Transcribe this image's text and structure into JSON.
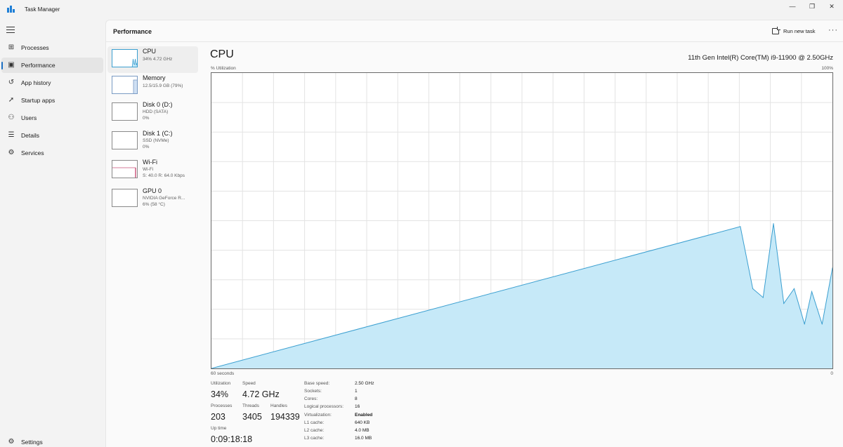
{
  "window": {
    "title": "Task Manager",
    "minimize": "—",
    "maximize": "❐",
    "close": "✕"
  },
  "nav": {
    "items": [
      {
        "label": "Processes",
        "icon": "processes-icon"
      },
      {
        "label": "Performance",
        "icon": "performance-icon",
        "selected": true
      },
      {
        "label": "App history",
        "icon": "app-history-icon"
      },
      {
        "label": "Startup apps",
        "icon": "startup-apps-icon"
      },
      {
        "label": "Users",
        "icon": "users-icon"
      },
      {
        "label": "Details",
        "icon": "details-icon"
      },
      {
        "label": "Services",
        "icon": "services-icon"
      }
    ],
    "settings": "Settings"
  },
  "header": {
    "title": "Performance",
    "run_new_task": "Run new task",
    "more": "···"
  },
  "resources": [
    {
      "name": "CPU",
      "line1": "34% 4.72 GHz",
      "line2": ""
    },
    {
      "name": "Memory",
      "line1": "12.5/15.9 GB (79%)",
      "line2": ""
    },
    {
      "name": "Disk 0 (D:)",
      "line1": "HDD (SATA)",
      "line2": "0%"
    },
    {
      "name": "Disk 1 (C:)",
      "line1": "SSD (NVMe)",
      "line2": "0%"
    },
    {
      "name": "Wi-Fi",
      "line1": "Wi-Fi",
      "line2": "S: 40.0 R: 64.0 Kbps"
    },
    {
      "name": "GPU 0",
      "line1": "NVIDIA GeForce R...",
      "line2": "6% (58 °C)"
    }
  ],
  "cpu": {
    "title": "CPU",
    "model": "11th Gen Intel(R) Core(TM) i9-11900 @ 2.50GHz",
    "util_label": "% Utilization",
    "util_max": "100%",
    "time_label": "60 seconds",
    "zero_label": "0",
    "colors": {
      "fill": "#c6e9f8",
      "line": "#3b9fd0",
      "grid": "#e3e3e3"
    }
  },
  "stats": {
    "utilization_label": "Utilization",
    "utilization": "34%",
    "speed_label": "Speed",
    "speed": "4.72 GHz",
    "processes_label": "Processes",
    "processes": "203",
    "threads_label": "Threads",
    "threads": "3405",
    "handles_label": "Handles",
    "handles": "194339",
    "uptime_label": "Up time",
    "uptime": "0:09:18:18"
  },
  "specs": [
    {
      "label": "Base speed:",
      "value": "2.50 GHz"
    },
    {
      "label": "Sockets:",
      "value": "1"
    },
    {
      "label": "Cores:",
      "value": "8"
    },
    {
      "label": "Logical processors:",
      "value": "16"
    },
    {
      "label": "Virtualization:",
      "value": "Enabled"
    },
    {
      "label": "L1 cache:",
      "value": "640 KB"
    },
    {
      "label": "L2 cache:",
      "value": "4.0 MB"
    },
    {
      "label": "L3 cache:",
      "value": "16.0 MB"
    }
  ],
  "chart_data": {
    "type": "area",
    "xlabel": "60 seconds",
    "ylabel": "% Utilization",
    "ylim": [
      0,
      100
    ],
    "xlim": [
      0,
      60
    ],
    "x_direction": "seconds ago, right edge is now",
    "series": [
      {
        "x": [
          60,
          8.9,
          7.7,
          6.7,
          5.7,
          4.7,
          3.7,
          2.7,
          2.0,
          1.0,
          0
        ],
        "values": [
          0,
          48,
          27,
          24,
          49,
          22,
          27,
          15,
          26,
          15,
          34
        ]
      }
    ],
    "grid": true
  }
}
